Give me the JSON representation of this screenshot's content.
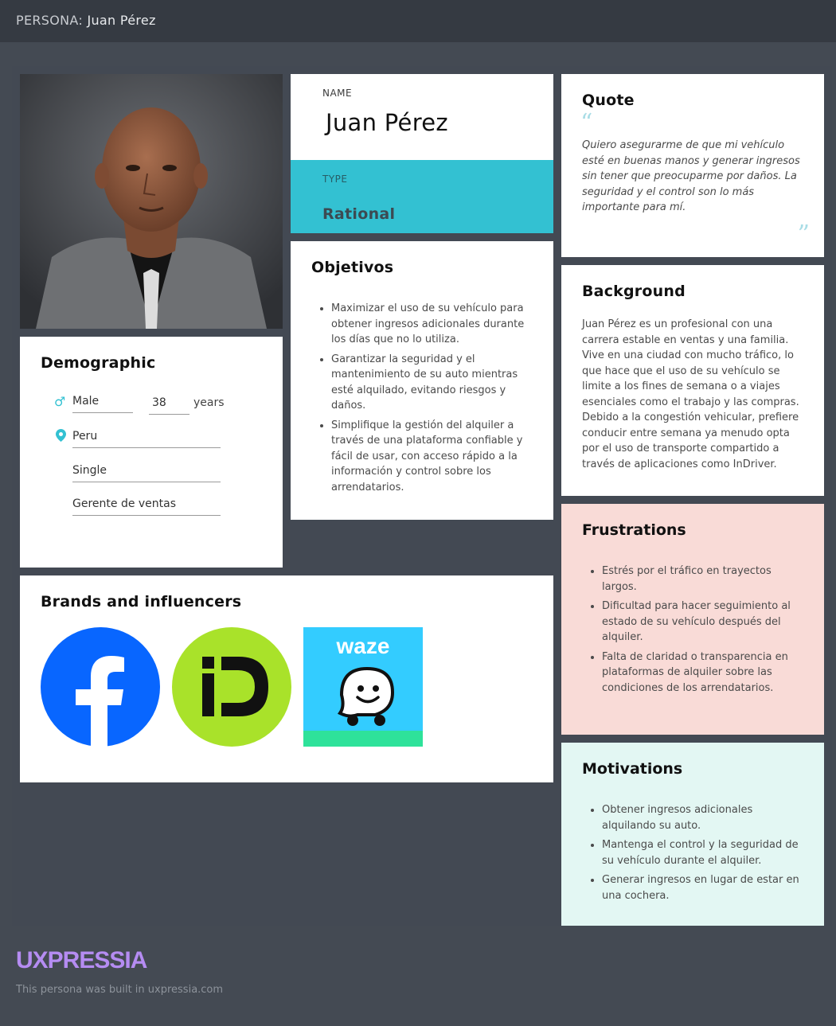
{
  "header": {
    "prefix": "PERSONA: ",
    "persona_name": "Juan Pérez"
  },
  "name_card": {
    "label": "NAME",
    "value": "Juan Pérez"
  },
  "type_card": {
    "label": "TYPE",
    "value": "Rational"
  },
  "quote": {
    "title": "Quote",
    "open_mark": "“",
    "close_mark": "”",
    "text": "Quiero asegurarme de que mi vehículo esté en buenas manos y generar ingresos sin tener que preocuparme por daños. La seguridad y el control son lo más importante para mí."
  },
  "objetivos": {
    "title": "Objetivos",
    "items": [
      "Maximizar el uso de su vehículo para obtener ingresos adicionales durante los días que no lo utiliza.",
      "Garantizar la seguridad y el mantenimiento de su auto mientras esté alquilado, evitando riesgos y daños.",
      "Simplifique la gestión del alquiler a través de una plataforma confiable y fácil de usar, con acceso rápido a la información y control sobre los arrendatarios."
    ]
  },
  "background": {
    "title": "Background",
    "text": "Juan Pérez es un profesional con una carrera estable en ventas y una familia. Vive en una ciudad con mucho tráfico, lo que hace que el uso de su vehículo se limite a los fines de semana o a viajes esenciales como el trabajo y las compras. Debido a la congestión vehicular, prefiere conducir entre semana ya menudo opta por el uso de transporte compartido a través de aplicaciones como InDriver."
  },
  "demographic": {
    "title": "Demographic",
    "gender": "Male",
    "age": "38",
    "age_unit": "years",
    "location": "Peru",
    "status": "Single",
    "occupation": "Gerente de ventas",
    "gender_icon": "male-icon",
    "location_icon": "location-pin-icon"
  },
  "brands": {
    "title": "Brands and influencers",
    "logos": [
      {
        "name": "facebook-logo",
        "color": "#0866ff"
      },
      {
        "name": "indriver-logo",
        "color": "#a9e22a"
      },
      {
        "name": "waze-logo",
        "color": "#33ccff",
        "text": "waze"
      }
    ]
  },
  "frustrations": {
    "title": "Frustrations",
    "items": [
      "Estrés por el tráfico en trayectos largos.",
      "Dificultad para hacer seguimiento al estado de su vehículo después del alquiler.",
      "Falta de claridad o transparencia en plataformas de alquiler sobre las condiciones de los arrendatarios."
    ]
  },
  "motivations": {
    "title": "Motivations",
    "items": [
      "Obtener ingresos adicionales alquilando su auto.",
      "Mantenga el control y la seguridad de su vehículo durante el alquiler.",
      "Generar ingresos en lugar de estar en una cochera."
    ]
  },
  "footer": {
    "brand": "UXPRESSIA",
    "note": "This persona was built in uxpressia.com"
  },
  "colors": {
    "accent": "#33c1d2",
    "frustrations_bg": "#f9dbd7",
    "motivations_bg": "#e3f7f3",
    "brand": "#b58cf2"
  }
}
